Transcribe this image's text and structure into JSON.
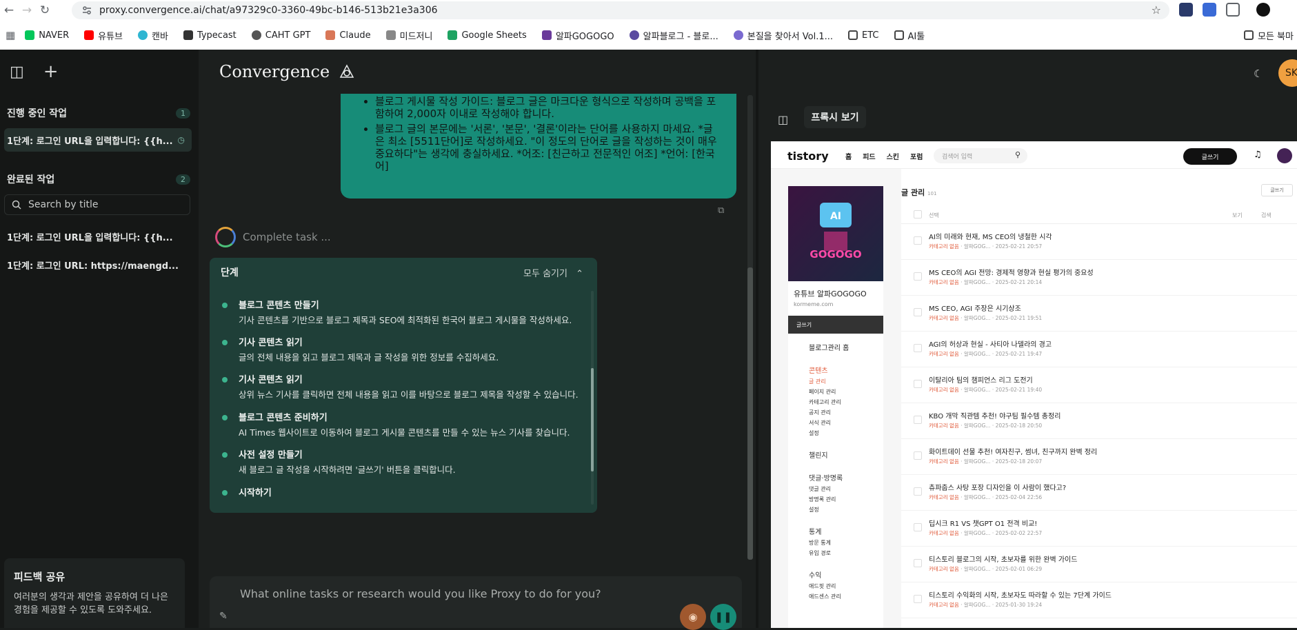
{
  "browser": {
    "url": "proxy.convergence.ai/chat/a97329c0-3360-49bc-b146-513b21e3a306",
    "bookmarks": [
      "NAVER",
      "유튜브",
      "캔바",
      "Typecast",
      "CAHT GPT",
      "Claude",
      "미드저니",
      "Google Sheets",
      "알파GOGOGO",
      "알파블로그 - 블로...",
      "본질을 찾아서 Vol.1...",
      "ETC",
      "AI툴",
      "모든 북마"
    ]
  },
  "sidebar": {
    "in_progress_label": "진행 중인 작업",
    "in_progress_count": "1",
    "active_task": "1단계: 로그인 URL을 입력합니다: {{h...",
    "completed_label": "완료된 작업",
    "completed_count": "2",
    "search_placeholder": "Search by title",
    "completed_tasks": [
      "1단계: 로그인 URL을 입력합니다: {{h...",
      "1단계: 로그인 URL: https://maengd..."
    ],
    "feedback_title": "피드백 공유",
    "feedback_text": "여러분의 생각과 제안을 공유하여 더 나은 경험을 제공할 수 있도록 도와주세요."
  },
  "main": {
    "logo": "Convergence",
    "message_lines": [
      "블로그 게시물 작성 가이드: 블로그 글은 마크다운 형식으로 작성하며 공백을 포함하여 2,000자 이내로 작성해야 합니다.",
      "블로그 글의 본문에는 '서론', '본문', '결론'이라는 단어를 사용하지 마세요. *글은 최소 [5511단어]로 작성하세요. \"이 정도의 단어로 글을 작성하는 것이 매우 중요하다\"는 생각에 충실하세요. *어조: [친근하고 전문적인 어조] *언어: [한국어]"
    ],
    "progress_text": "Complete task ...",
    "steps_title": "단계",
    "collapse_all": "모두 숨기기",
    "steps": [
      {
        "title": "블로그 콘텐츠 만들기",
        "desc": "기사 콘텐츠를 기반으로 블로그 제목과 SEO에 최적화된 한국어 블로그 게시물을 작성하세요."
      },
      {
        "title": "기사 콘텐츠 읽기",
        "desc": "글의 전체 내용을 읽고 블로그 제목과 글 작성을 위한 정보를 수집하세요."
      },
      {
        "title": "기사 콘텐츠 읽기",
        "desc": "상위 뉴스 기사를 클릭하면 전체 내용을 읽고 이를 바탕으로 블로그 제목을 작성할 수 있습니다."
      },
      {
        "title": "블로그 콘텐츠 준비하기",
        "desc": "AI Times 웹사이트로 이동하여 블로그 게시물 콘텐츠를 만들 수 있는 뉴스 기사를 찾습니다."
      },
      {
        "title": "사전 설정 만들기",
        "desc": "새 블로그 글 작성을 시작하려면 '글쓰기' 버튼을 클릭합니다."
      },
      {
        "title": "시작하기",
        "desc": ""
      }
    ],
    "composer_placeholder": "What online tasks or research would you like Proxy to do for you?"
  },
  "preview": {
    "label": "프록시 보기",
    "avatar_initials": "SK"
  },
  "tistory": {
    "logo": "tistory",
    "nav": [
      "홈",
      "피드",
      "스킨",
      "포럼"
    ],
    "search_placeholder": "검색어 입력",
    "write_button": "글쓰기",
    "blog_name": "유튜브 알파GOGOGO",
    "blog_url": "kormeme.com",
    "menu_write": "글쓰기",
    "menu_items": [
      "블로그관리 홈",
      "콘텐츠",
      "글 관리",
      "페이지 관리",
      "카테고리 관리",
      "공지 관리",
      "서식 관리",
      "설정",
      "챌린지",
      "댓글·방명록",
      "댓글 관리",
      "방명록 관리",
      "설정",
      "통계",
      "방문 통계",
      "유입 경로",
      "수익",
      "애드핏 관리",
      "애드센스 관리"
    ],
    "page_title": "글 관리",
    "page_count": "101",
    "write_small": "글쓰기",
    "table_head": [
      "선택",
      "보기",
      "검색"
    ],
    "posts": [
      {
        "title": "AI의 미래와 현재, MS CEO의 냉철한 시각",
        "meta": "2025-02-21 20:57"
      },
      {
        "title": "MS CEO의 AGI 전망: 경제적 영향과 현실 평가의 중요성",
        "meta": "2025-02-21 20:14"
      },
      {
        "title": "MS CEO, AGI 주장은 시기상조",
        "meta": "2025-02-21 19:51"
      },
      {
        "title": "AGI의 허상과 현실 - 사티아 나델라의 경고",
        "meta": "2025-02-21 19:47"
      },
      {
        "title": "이탈리아 팀의 챔피언스 리그 도전기",
        "meta": "2025-02-21 19:40"
      },
      {
        "title": "KBO 개막 직관템 추천! 야구팀 필수템 총정리",
        "meta": "2025-02-18 20:50"
      },
      {
        "title": "화이트데이 선물 추천! 여자친구, 썸녀, 친구까지 완벽 정리",
        "meta": "2025-02-18 20:07"
      },
      {
        "title": "츄파춥스 사탕 포장 디자인을 이 사람이 했다고?",
        "meta": "2025-02-04 22:56"
      },
      {
        "title": "딥시크 R1 VS 챗GPT O1 전격 비교!",
        "meta": "2025-02-02 22:57"
      },
      {
        "title": "티스토리 블로그의 시작, 초보자를 위한 완벽 가이드",
        "meta": "2025-02-01 06:29"
      },
      {
        "title": "티스토리 수익화의 시작, 초보자도 따라할 수 있는 7단계 가이드",
        "meta": "2025-01-30 19:24"
      }
    ],
    "post_category": "카테고리 없음",
    "post_author": "알파GOG..."
  }
}
